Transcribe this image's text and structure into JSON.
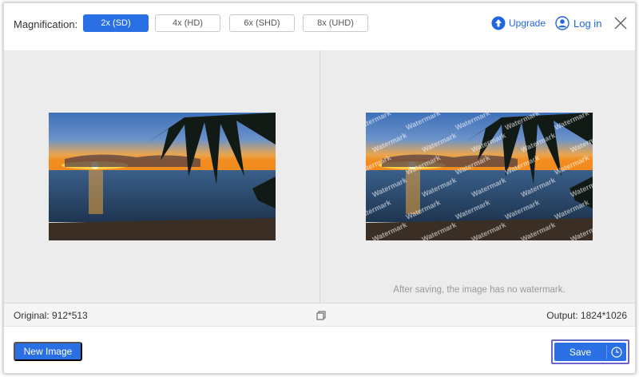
{
  "header": {
    "magnification_label": "Magnification:",
    "options": [
      {
        "label": "2x (SD)",
        "active": true
      },
      {
        "label": "4x (HD)",
        "active": false
      },
      {
        "label": "6x (SHD)",
        "active": false
      },
      {
        "label": "8x (UHD)",
        "active": false
      }
    ],
    "upgrade_label": "Upgrade",
    "login_label": "Log in"
  },
  "preview": {
    "watermark_text": "Watermark",
    "no_watermark_note": "After saving, the image has no watermark."
  },
  "info": {
    "original": "Original: 912*513",
    "output": "Output: 1824*1026"
  },
  "footer": {
    "new_image_label": "New Image",
    "save_label": "Save"
  },
  "colors": {
    "accent": "#2a6fe3",
    "link": "#1f66e0",
    "save_focus_border": "#6a63c9"
  },
  "icons": [
    "upgrade-icon",
    "user-icon",
    "close-icon",
    "copy-icon",
    "clock-icon"
  ]
}
